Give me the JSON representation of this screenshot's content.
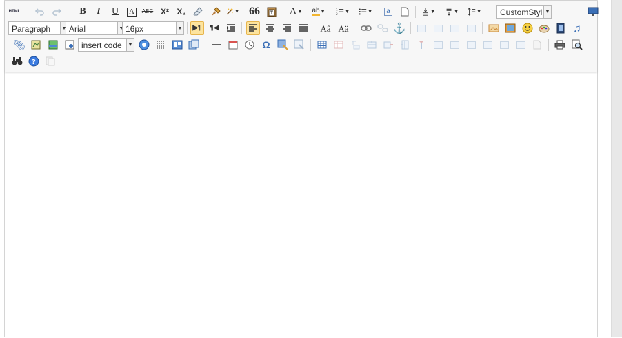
{
  "toolbar": {
    "row1": {
      "html_label": "HTML",
      "bold": "B",
      "italic": "I",
      "underline": "U",
      "strike": "ABC",
      "superscript": "X²",
      "subscript": "X₂",
      "blockquote": "66",
      "font_color": "A",
      "highlight": "ab",
      "custom_style": "CustomStyl"
    },
    "row2": {
      "paragraph": "Paragraph",
      "font_family": "Arial",
      "font_size": "16px",
      "ltr": "▶¶",
      "rtl": "¶◀"
    },
    "row3": {
      "insert_code": "insert code",
      "omega": "Ω"
    }
  },
  "icons": {
    "row1": [
      "html-icon",
      "undo-icon",
      "redo-icon",
      "bold-icon",
      "italic-icon",
      "underline-icon",
      "font-border-icon",
      "strikethrough-icon",
      "superscript-icon",
      "subscript-icon",
      "eraser-icon",
      "format-brush-icon",
      "magic-wand-icon",
      "quote-icon",
      "paste-icon",
      "font-color-icon",
      "highlight-icon",
      "ordered-list-icon",
      "unordered-list-icon",
      "text-frame-icon",
      "page-icon",
      "row-spacing-top-icon",
      "row-spacing-bottom-icon",
      "line-height-icon",
      "fullscreen-icon"
    ],
    "row2": [
      "direction-ltr-icon",
      "direction-rtl-icon",
      "indent-icon",
      "align-left-icon",
      "align-center-icon",
      "align-right-icon",
      "justify-icon",
      "touppercase-icon",
      "tolowercase-icon",
      "link-icon",
      "unlink-icon",
      "anchor-icon",
      "image-none-icon",
      "image-left-icon",
      "image-right-icon",
      "image-center-icon",
      "simple-upload-icon",
      "insert-image-icon",
      "emotion-icon",
      "scrawl-icon",
      "video-icon",
      "music-icon"
    ],
    "row3": [
      "attachment-icon",
      "map-icon",
      "gmap-icon",
      "insert-frame-icon",
      "webapp-icon",
      "pagebreak-icon",
      "template-icon",
      "background-icon",
      "horizontal-rule-icon",
      "date-icon",
      "time-icon",
      "special-char-icon",
      "wordimage-icon",
      "edittip-icon",
      "insert-table-icon",
      "delete-table-icon",
      "insert-paragraph-before-table-icon",
      "insert-row-icon",
      "delete-row-icon",
      "insert-col-icon",
      "delete-col-icon",
      "merge-cells-icon",
      "merge-right-icon",
      "merge-down-icon",
      "split-cells-icon",
      "split-rows-icon",
      "split-cols-icon",
      "charts-icon",
      "print-icon",
      "preview-icon"
    ],
    "row4": [
      "search-replace-icon",
      "help-icon",
      "drafts-icon"
    ]
  },
  "colors": {
    "toolbar_bg": "#f7f7f7",
    "active_bg": "#fde49e",
    "icon_blue": "#3b6fb6",
    "disabled": "#b7c5d3",
    "border": "#d4d4d4"
  },
  "editor": {
    "content": ""
  }
}
